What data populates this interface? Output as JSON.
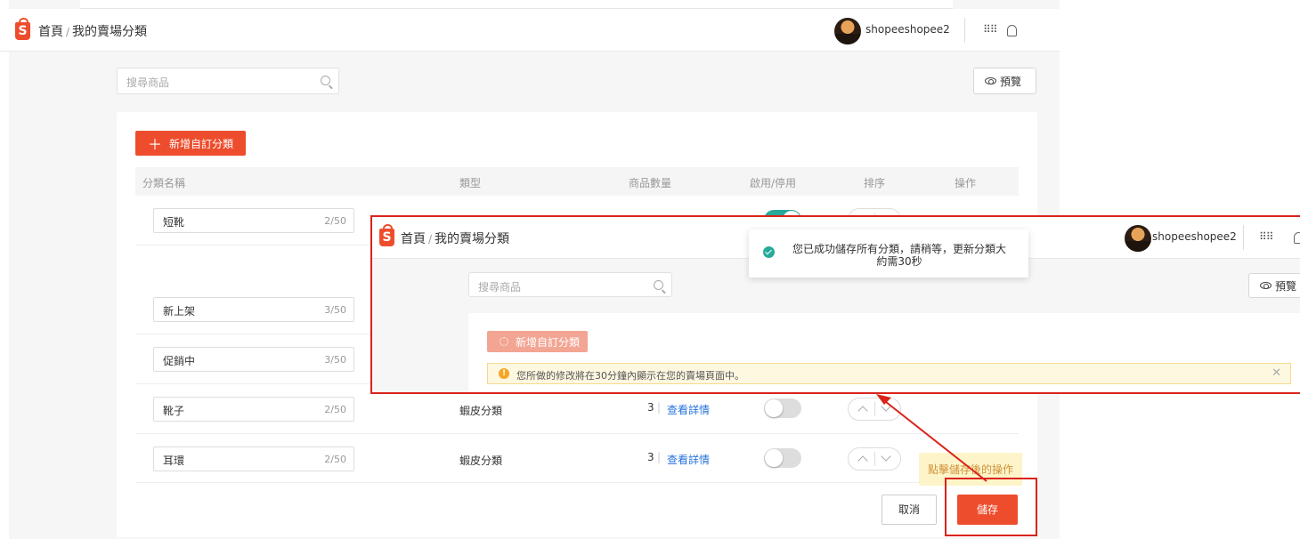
{
  "header": {
    "breadcrumb_home": "首頁",
    "breadcrumb_sep": "/",
    "breadcrumb_current": "我的賣場分類",
    "username": "shopeeshopee2",
    "logo_letter": "S"
  },
  "search": {
    "placeholder": "搜尋商品"
  },
  "preview_label": "預覽",
  "add_category_label": "新增自訂分類",
  "table": {
    "headers": {
      "name": "分類名稱",
      "type": "類型",
      "count": "商品數量",
      "enable": "啟用/停用",
      "sort": "排序",
      "action": "操作"
    },
    "rows": [
      {
        "name": "短靴",
        "chars": "2/50",
        "type": "",
        "count": "",
        "link": "",
        "enabled": true
      },
      {
        "name": "新上架",
        "chars": "3/50"
      },
      {
        "name": "促銷中",
        "chars": "3/50"
      },
      {
        "name": "靴子",
        "chars": "2/50",
        "type": "蝦皮分類",
        "count": "3",
        "link": "查看詳情",
        "enabled": false
      },
      {
        "name": "耳環",
        "chars": "2/50",
        "type": "蝦皮分類",
        "count": "3",
        "link": "查看詳情",
        "enabled": false
      }
    ]
  },
  "tooltip": "點擊儲存後的操作",
  "buttons": {
    "cancel": "取消",
    "save": "儲存"
  },
  "overlay": {
    "toast": "您已成功儲存所有分類，請稍等，更新分類大約需30秒",
    "warning": "您所做的修改將在30分鐘內顯示在您的賣場頁面中。"
  },
  "colors": {
    "brand": "#ee4d2d",
    "toggle_on": "#26aa99",
    "link": "#2673dd",
    "annotation": "#d9231b"
  }
}
